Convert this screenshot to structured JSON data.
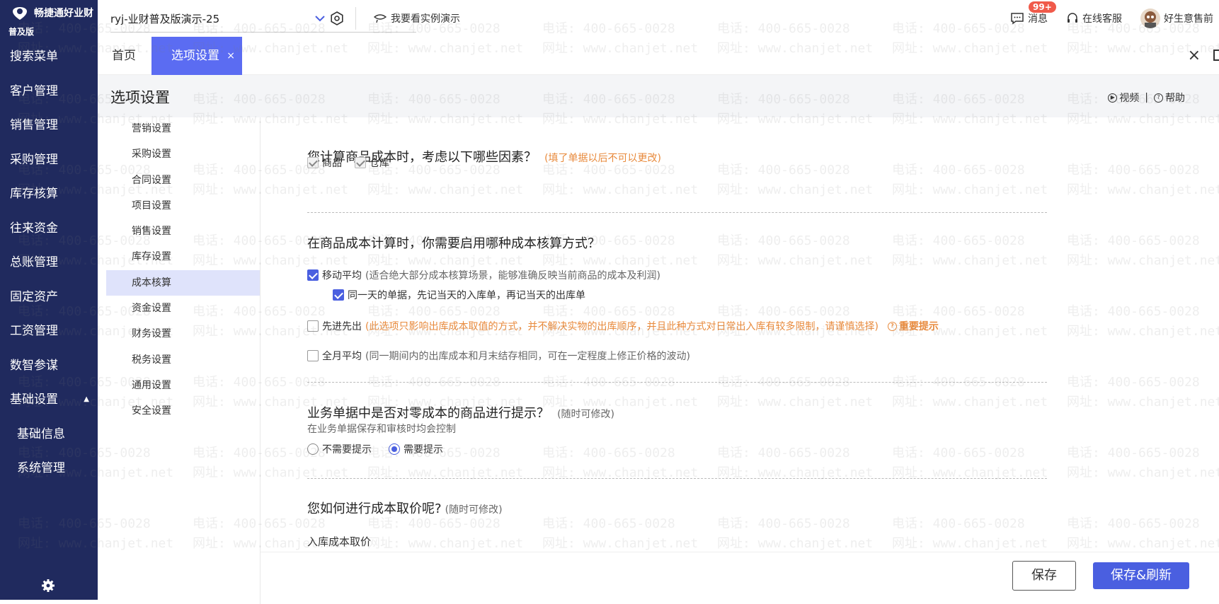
{
  "nav": {
    "brand_name": "畅捷通好业财",
    "brand_edition": "普及版",
    "items": [
      {
        "label": "搜索菜单"
      },
      {
        "label": "客户管理"
      },
      {
        "label": "销售管理"
      },
      {
        "label": "采购管理"
      },
      {
        "label": "库存核算"
      },
      {
        "label": "往来资金"
      },
      {
        "label": "总账管理"
      },
      {
        "label": "固定资产"
      },
      {
        "label": "工资管理"
      },
      {
        "label": "数智参谋"
      },
      {
        "label": "基础设置"
      }
    ],
    "sub_items": [
      {
        "label": "基础信息"
      },
      {
        "label": "系统管理"
      }
    ]
  },
  "topbar": {
    "account": "ryj-业财普及版演示-25",
    "demo_label": "我要看实例演示",
    "messages_label": "消息",
    "messages_badge": "99+",
    "service_label": "在线客服",
    "user_label": "好生意售前"
  },
  "tabs": {
    "home": "首页",
    "active": "选项设置",
    "active_close": "×",
    "close_all": "×"
  },
  "page": {
    "title": "选项设置",
    "video_label": "视频",
    "separator": "|",
    "help_label": "帮助"
  },
  "submenu": {
    "items": [
      {
        "label": "营销设置"
      },
      {
        "label": "采购设置"
      },
      {
        "label": "合同设置"
      },
      {
        "label": "项目设置"
      },
      {
        "label": "销售设置"
      },
      {
        "label": "库存设置"
      },
      {
        "label": "成本核算"
      },
      {
        "label": "资金设置"
      },
      {
        "label": "财务设置"
      },
      {
        "label": "税务设置"
      },
      {
        "label": "通用设置"
      },
      {
        "label": "安全设置"
      }
    ],
    "active_index": 6
  },
  "content": {
    "s1": {
      "title": "您计算商品成本时，考虑以下哪些因素？",
      "note": "(填了单据以后不可以更改)",
      "opt_goods": "商品",
      "opt_warehouse": "仓库"
    },
    "s2": {
      "title": "在商品成本计算时，你需要启用哪种成本核算方式？",
      "opt_moving": "移动平均",
      "opt_moving_note": "(适合绝大部分成本核算场景，能够准确反映当前商品的成本及利润)",
      "opt_same_day": "同一天的单据，先记当天的入库单，再记当天的出库单",
      "opt_fifo": "先进先出",
      "opt_fifo_note": "(此选项只影响出库成本取值的方式，并不解决实物的出库顺序，并且此种方式对日常出入库有较多限制，请谨慎选择)",
      "fifo_warning": "重要提示",
      "opt_monthly": "全月平均",
      "opt_monthly_note": "(同一期间内的出库成本和月末结存相同，可在一定程度上修正价格的波动)"
    },
    "s3": {
      "title": "业务单据中是否对零成本的商品进行提示？",
      "note": "(随时可修改)",
      "desc": "在业务单据保存和审核时均会控制",
      "opt_no": "不需要提示",
      "opt_yes": "需要提示"
    },
    "s4": {
      "title": "您如何进行成本取价呢?",
      "note": "(随时可修改)",
      "sub": "入库成本取价"
    }
  },
  "footer": {
    "save": "保存",
    "save_refresh": "保存&刷新"
  },
  "watermark": {
    "phone": "电话: 400-665-0028",
    "site": "网址: www.chanjet.net"
  },
  "colors": {
    "nav_bg": "#202a5e",
    "accent": "#4a5fe0",
    "tab_active": "#5b6cf2",
    "warning": "#e88a3c",
    "badge": "#f05a4a"
  }
}
